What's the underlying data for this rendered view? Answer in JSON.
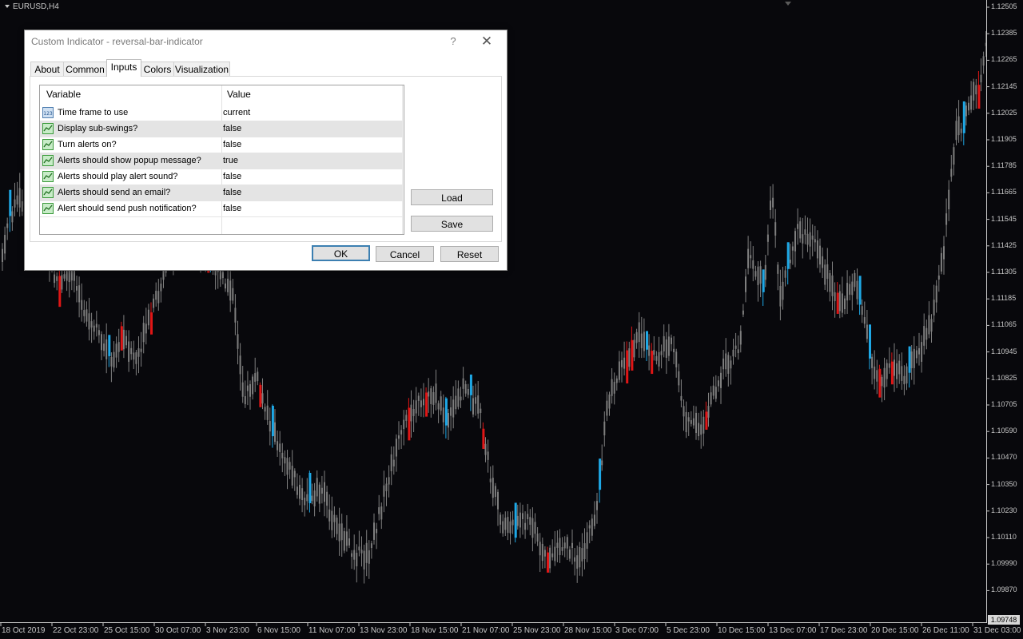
{
  "chart": {
    "symbol": "EURUSD,H4",
    "price_ticks": [
      "1.12505",
      "1.12385",
      "1.12265",
      "1.12145",
      "1.12025",
      "1.11905",
      "1.11785",
      "1.11665",
      "1.11545",
      "1.11425",
      "1.11305",
      "1.11185",
      "1.11065",
      "1.10945",
      "1.10825",
      "1.10705",
      "1.10590",
      "1.10470",
      "1.10350",
      "1.10230",
      "1.10110",
      "1.09990",
      "1.09870"
    ],
    "current_price": "1.09748",
    "date_ticks": [
      "18 Oct 2019",
      "22 Oct 23:00",
      "25 Oct 15:00",
      "30 Oct 07:00",
      "3 Nov 23:00",
      "6 Nov 15:00",
      "11 Nov 07:00",
      "13 Nov 23:00",
      "18 Nov 15:00",
      "21 Nov 07:00",
      "25 Nov 23:00",
      "28 Nov 15:00",
      "3 Dec 07:00",
      "5 Dec 23:00",
      "10 Dec 15:00",
      "13 Dec 07:00",
      "17 Dec 23:00",
      "20 Dec 15:00",
      "26 Dec 11:00",
      "31 Dec 03:00"
    ],
    "colors": {
      "background": "#08080c",
      "neutral_bar": "#7f7f7f",
      "bull_reversal": "#1ea8e6",
      "bear_reversal": "#e01616"
    }
  },
  "dialog": {
    "title": "Custom Indicator - reversal-bar-indicator",
    "help_icon": "?",
    "close_icon": "✕",
    "tabs": [
      "About",
      "Common",
      "Inputs",
      "Colors",
      "Visualization"
    ],
    "active_tab": "Inputs",
    "table": {
      "headers": {
        "variable": "Variable",
        "value": "Value"
      },
      "rows": [
        {
          "icon": "numeric-input-icon",
          "variable": "Time frame to use",
          "value": "current"
        },
        {
          "icon": "boolean-input-icon",
          "variable": "Display sub-swings?",
          "value": "false"
        },
        {
          "icon": "boolean-input-icon",
          "variable": "Turn alerts on?",
          "value": "false"
        },
        {
          "icon": "boolean-input-icon",
          "variable": "Alerts should show popup message?",
          "value": "true"
        },
        {
          "icon": "boolean-input-icon",
          "variable": "Alerts should play alert sound?",
          "value": "false"
        },
        {
          "icon": "boolean-input-icon",
          "variable": "Alerts should send an email?",
          "value": "false"
        },
        {
          "icon": "boolean-input-icon",
          "variable": "Alert should send push notification?",
          "value": "false"
        }
      ]
    },
    "buttons": {
      "load": "Load",
      "save": "Save",
      "ok": "OK",
      "cancel": "Cancel",
      "reset": "Reset"
    }
  }
}
